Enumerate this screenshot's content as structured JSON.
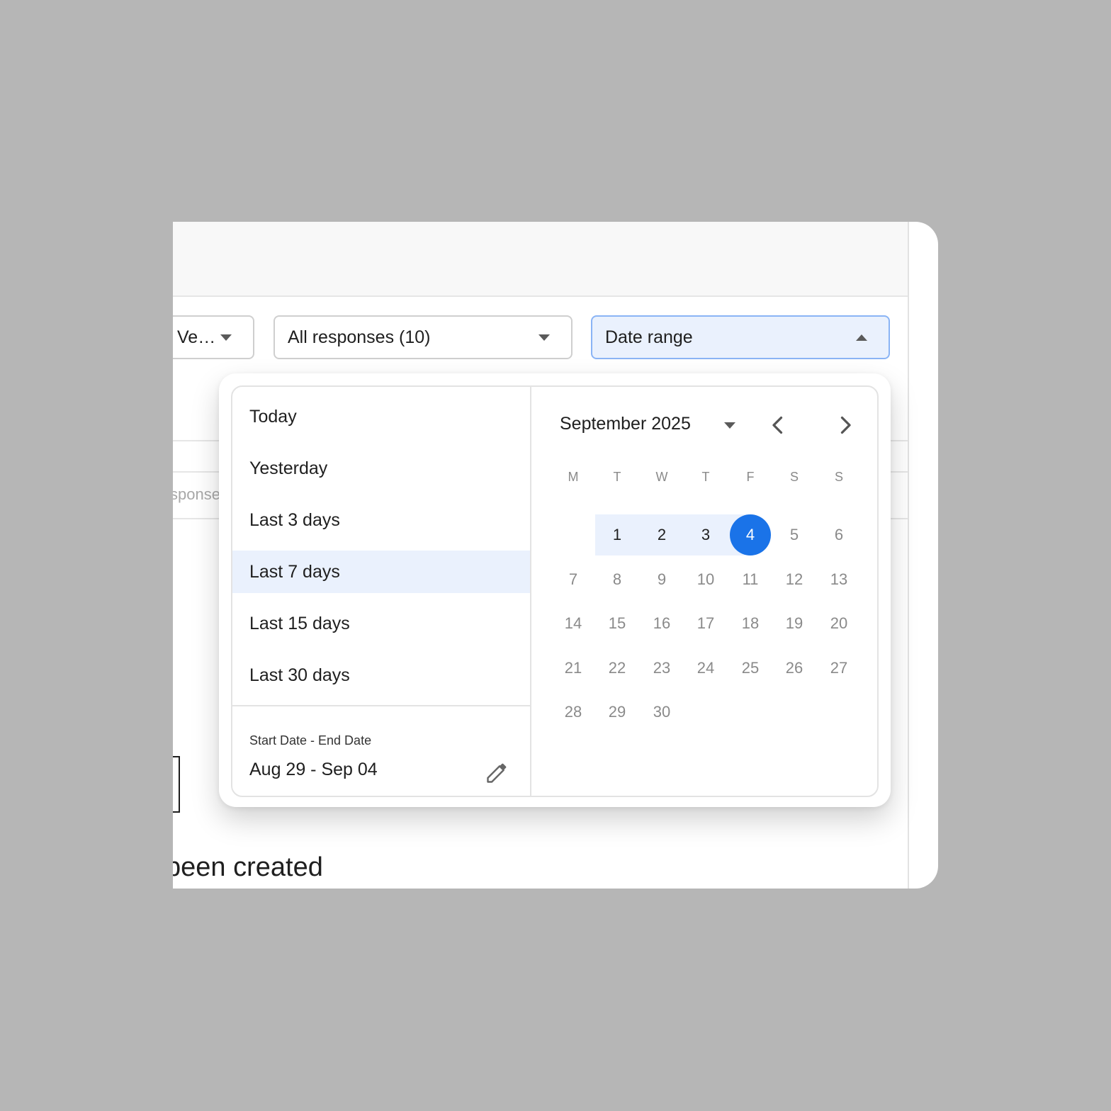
{
  "toolbar": {
    "version_filter": "Ve…",
    "responses_filter": "All responses (10)",
    "date_filter": "Date range"
  },
  "background": {
    "faint_label": "sponse",
    "empty_heading": "been created"
  },
  "presets": [
    {
      "label": "Today",
      "active": false
    },
    {
      "label": "Yesterday",
      "active": false
    },
    {
      "label": "Last 3 days",
      "active": false
    },
    {
      "label": "Last 7 days",
      "active": true
    },
    {
      "label": "Last 15 days",
      "active": false
    },
    {
      "label": "Last 30 days",
      "active": false
    }
  ],
  "range": {
    "label": "Start Date - End Date",
    "value": "Aug 29 - Sep 04"
  },
  "calendar": {
    "month_label": "September 2025",
    "weekdays": [
      "M",
      "T",
      "W",
      "T",
      "F",
      "S",
      "S"
    ],
    "first_weekday_index": 1,
    "days_in_month": 30,
    "range_days": [
      1,
      2,
      3,
      4
    ],
    "selected_day": 4
  },
  "colors": {
    "accent": "#1a73e8",
    "range_bg": "#eaf1fd",
    "muted_text": "#8a8a8a"
  },
  "icons": {
    "caret_down": "chevron-down-icon",
    "caret_up": "chevron-up-icon",
    "prev": "chevron-left-icon",
    "next": "chevron-right-icon",
    "edit": "pencil-icon"
  }
}
